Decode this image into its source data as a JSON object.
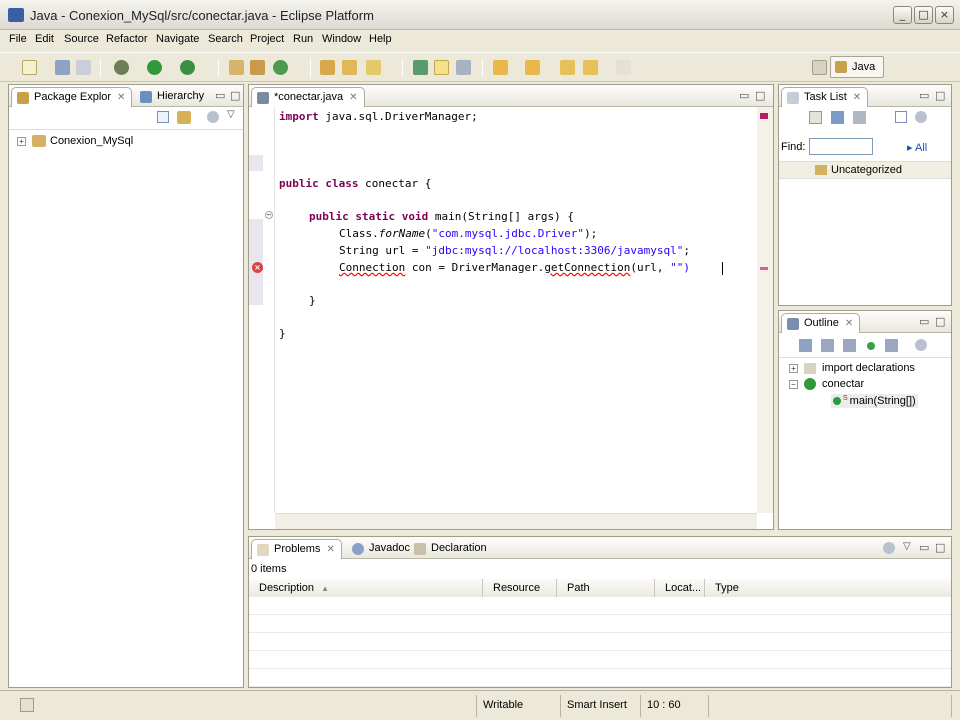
{
  "window": {
    "title": "Java - Conexion_MySql/src/conectar.java - Eclipse Platform",
    "minimize": "_",
    "maximize": "□",
    "close": "×"
  },
  "menu": [
    "File",
    "Edit",
    "Source",
    "Refactor",
    "Navigate",
    "Search",
    "Project",
    "Run",
    "Window",
    "Help"
  ],
  "toolbar": {
    "perspective_label": "Java"
  },
  "package_explorer": {
    "tabs": [
      "Package Explor",
      "Hierarchy"
    ],
    "project": "Conexion_MySql",
    "expander": "+"
  },
  "editor": {
    "tab": "*conectar.java",
    "lines": {
      "l1_kw": "import",
      "l1_rest": " java.sql.DriverManager;",
      "l4_kw1": "public",
      "l4_kw2": "class",
      "l4_rest": " conectar {",
      "l6_kw1": "public",
      "l6_kw2": "static",
      "l6_kw3": "void",
      "l6_rest": " main(String[] args) {",
      "l7_a": "Class.",
      "l7_b": "forName",
      "l7_c": "(",
      "l7_str": "\"com.mysql.jdbc.Driver\"",
      "l7_d": ");",
      "l8_a": "String url = ",
      "l8_str": "\"jdbc:mysql://localhost:3306/javamysql\"",
      "l8_b": ";",
      "l9_err": "Connection",
      "l9_a": " con = DriverManager.",
      "l9_err2": "getConnection",
      "l9_b": "(url, ",
      "l9_str": "\"\")",
      "l11": "}",
      "l13": "}"
    },
    "error_marker": "×",
    "fold_marker": "−"
  },
  "task_list": {
    "tab": "Task List",
    "find_label": "Find:",
    "find_value": "",
    "all_label": "All",
    "category": "Uncategorized"
  },
  "outline": {
    "tab": "Outline",
    "items": [
      "import declarations",
      "conectar",
      "main(String[])"
    ],
    "static_marker": "S"
  },
  "problems": {
    "tabs": [
      "Problems",
      "Javadoc",
      "Declaration"
    ],
    "count": "0 items",
    "columns": [
      "Description",
      "Resource",
      "Path",
      "Locat...",
      "Type"
    ],
    "sort_arrow": "▲"
  },
  "status": {
    "writable": "Writable",
    "insert_mode": "Smart Insert",
    "position": "10 : 60"
  },
  "colors": {
    "keyword": "#7f0055",
    "string": "#2a00ff",
    "error": "#ff0000",
    "chrome": "#ece9d8"
  }
}
